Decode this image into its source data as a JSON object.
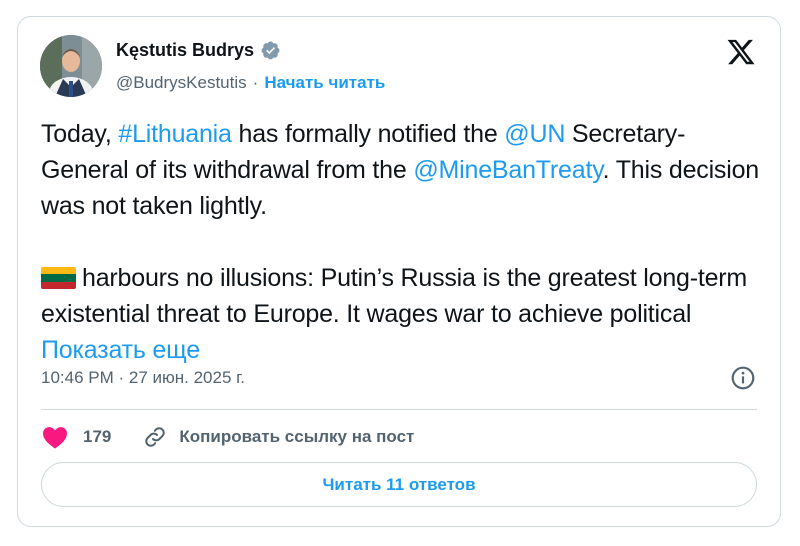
{
  "author": {
    "name": "Kęstutis Budrys",
    "handle": "@BudrysKestutis",
    "separator": "·",
    "follow_label": "Начать читать"
  },
  "tweet": {
    "p1": {
      "t1": "Today, ",
      "hashtag": "#Lithuania",
      "t2": " has formally notified the ",
      "mention_un": "@UN",
      "t3": " Secretary-General of its withdrawal from the ",
      "mention_treaty": "@MineBanTreaty",
      "t4": ". This decision was not taken lightly."
    },
    "p2": {
      "text": "harbours no illusions: Putin’s Russia is the greatest long-term existential threat to Europe. It wages war to achieve political ",
      "show_more": "Показать еще"
    }
  },
  "flag_colors": [
    "#fdb913",
    "#006a44",
    "#c1272d"
  ],
  "meta": {
    "time": "10:46 PM · 27 июн. 2025 г."
  },
  "actions": {
    "likes": "179",
    "copy_link": "Копировать ссылку на пост",
    "heart_color": "#f91880"
  },
  "replies_button": "Читать 11 ответов",
  "colors": {
    "accent": "#1d9bf0",
    "secondary_text": "#536471",
    "border": "#cfd9de"
  }
}
